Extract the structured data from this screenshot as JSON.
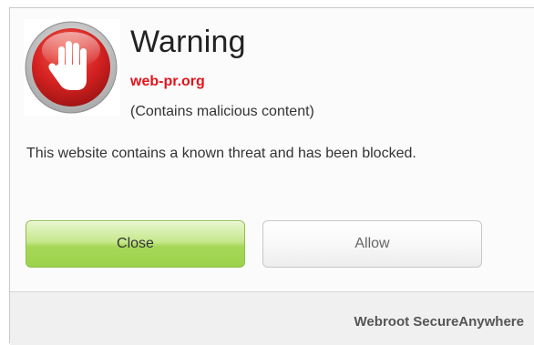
{
  "dialog": {
    "title": "Warning",
    "site": "web-pr.org",
    "reason": "(Contains malicious content)",
    "message": "This website contains a known threat and has been blocked."
  },
  "buttons": {
    "close_label": "Close",
    "allow_label": "Allow"
  },
  "footer": {
    "brand": "Webroot SecureAnywhere"
  },
  "icons": {
    "warning": "stop-hand-icon"
  },
  "colors": {
    "site_text": "#e3141c",
    "close_button": "#b5de6f",
    "icon_red": "#d52222"
  }
}
